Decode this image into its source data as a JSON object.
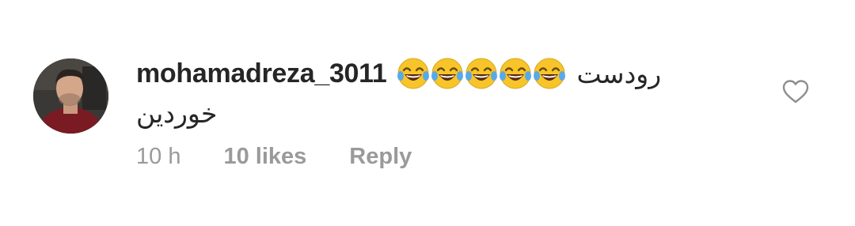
{
  "comment": {
    "username": "mohamadreza_3011",
    "emoji_icon": "face-with-tears-of-joy-icon",
    "emoji_count": 5,
    "text_line1": "رودست",
    "text_line2": "خوردین",
    "time": "10 h",
    "likes": "10 likes",
    "reply_label": "Reply",
    "like_icon": "heart-outline-icon"
  },
  "colors": {
    "text": "#262626",
    "meta": "#9a9a9a",
    "emoji_face": "#f7c52a",
    "tear": "#5aa9e6"
  }
}
